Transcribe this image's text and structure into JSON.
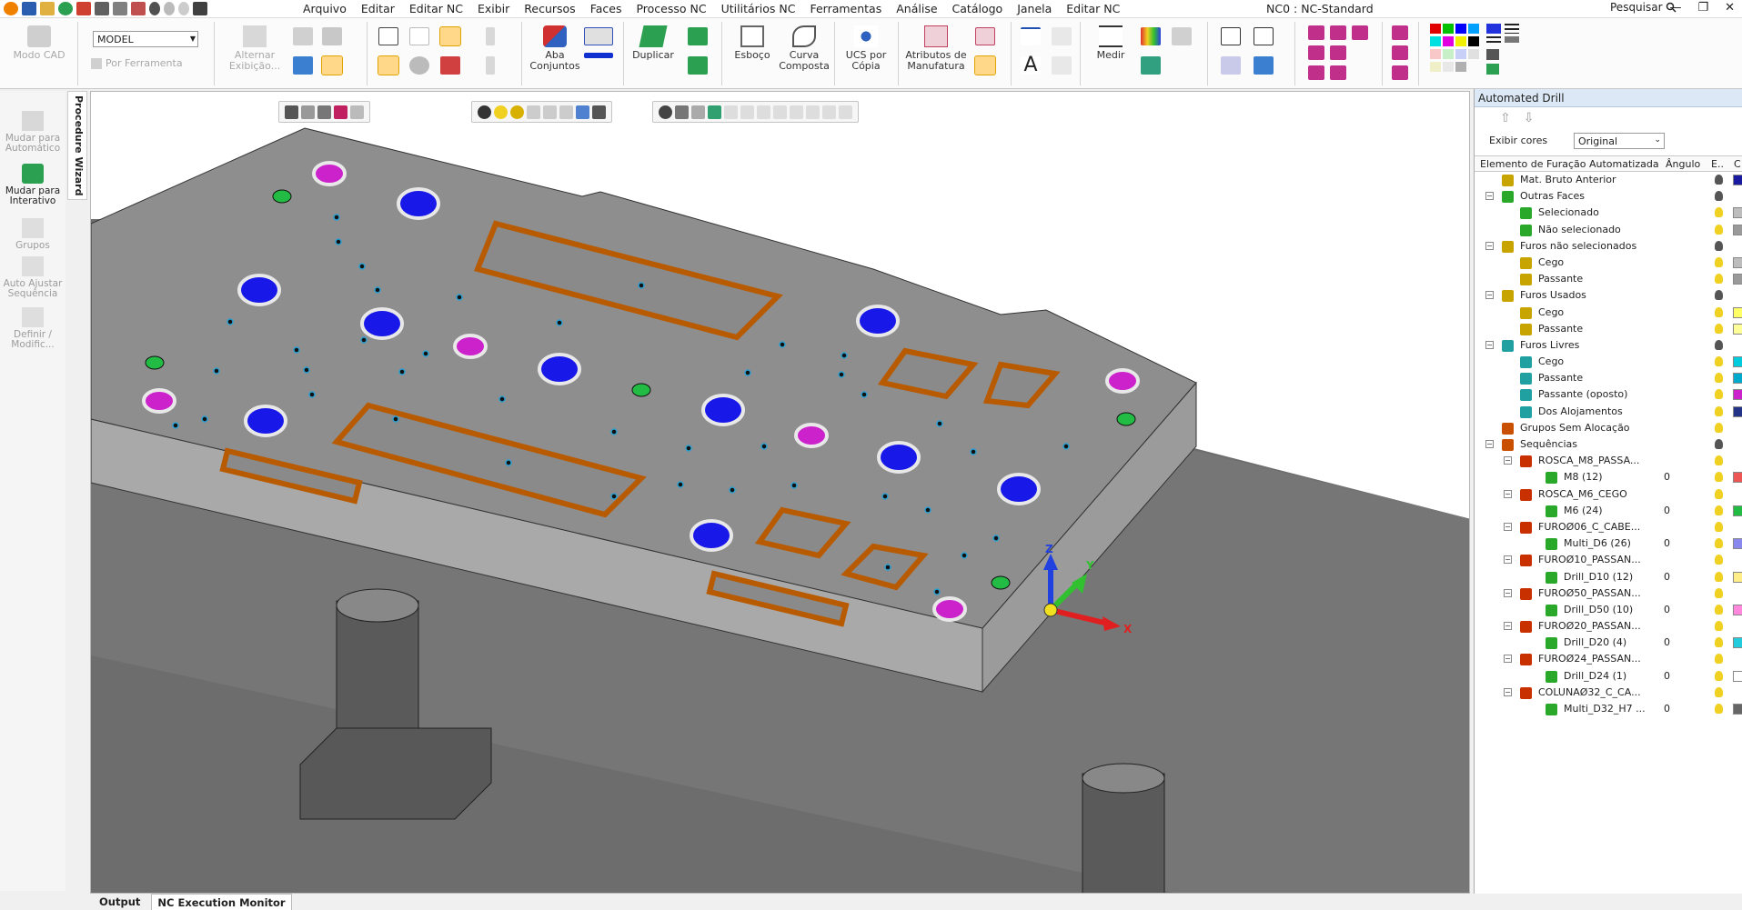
{
  "menu": [
    "Arquivo",
    "Editar",
    "Editar NC",
    "Exibir",
    "Recursos",
    "Faces",
    "Processo NC",
    "Utilitários NC",
    "Ferramentas",
    "Análise",
    "Catálogo",
    "Janela",
    "Editar NC"
  ],
  "app_title": "NC0 : NC-Standard",
  "search_label": "Pesquisar",
  "window_controls": [
    "—",
    "❐",
    "✕"
  ],
  "ribbon": {
    "modo_cad": "Modo CAD",
    "model_select": "MODEL",
    "por_ferramenta": "Por Ferramenta",
    "alternar_exibicao": "Alternar Exibição...",
    "aba_conjuntos": "Aba Conjuntos",
    "duplicar": "Duplicar",
    "esboco": "Esboço",
    "curva_composta": "Curva Composta",
    "ucs_por_copia": "UCS por Cópia",
    "atributos_manufatura": "Atributos de Manufatura",
    "medir": "Medir"
  },
  "left_panel": {
    "wizard_tab": "Procedure Wizard",
    "items": [
      {
        "label": "Mudar para Automático",
        "active": false
      },
      {
        "label": "Mudar para Interativo",
        "active": true
      },
      {
        "label": "Grupos",
        "active": false
      },
      {
        "label": "Auto Ajustar Sequência",
        "active": false
      },
      {
        "label": "Definir / Modific...",
        "active": false
      }
    ]
  },
  "bottom_tabs": [
    "Output",
    "NC Execution Monitor"
  ],
  "axes": {
    "x": "X",
    "y": "Y",
    "z": "Z"
  },
  "drill_panel": {
    "title": "Automated Drill",
    "exibir_cores_label": "Exibir cores",
    "exibir_cores_value": "Original",
    "col_element": "Elemento de Furação Automatizada",
    "col_angle": "Ângulo",
    "col_e": "E..",
    "col_c": "C",
    "rows": [
      {
        "label": "Mat. Bruto Anterior",
        "level": 1,
        "toggle": "",
        "icon": "#c8a400",
        "value": "",
        "swatch": "#1a1aa0"
      },
      {
        "label": "Outras Faces",
        "level": 1,
        "toggle": "−",
        "icon": "#2aa82a",
        "value": "",
        "swatch": ""
      },
      {
        "label": "Selecionado",
        "level": 2,
        "toggle": "",
        "icon": "#2aa82a",
        "value": "",
        "swatch": "#bdbdbd"
      },
      {
        "label": "Não selecionado",
        "level": 2,
        "toggle": "",
        "icon": "#2aa82a",
        "value": "",
        "swatch": "#9a9a9a"
      },
      {
        "label": "Furos não selecionados",
        "level": 1,
        "toggle": "−",
        "icon": "#c8a400",
        "value": "",
        "swatch": ""
      },
      {
        "label": "Cego",
        "level": 2,
        "toggle": "",
        "icon": "#c8a400",
        "value": "",
        "swatch": "#bdbdbd"
      },
      {
        "label": "Passante",
        "level": 2,
        "toggle": "",
        "icon": "#c8a400",
        "value": "",
        "swatch": "#9a9a9a"
      },
      {
        "label": "Furos Usados",
        "level": 1,
        "toggle": "−",
        "icon": "#c8a400",
        "value": "",
        "swatch": ""
      },
      {
        "label": "Cego",
        "level": 2,
        "toggle": "",
        "icon": "#c8a400",
        "value": "",
        "swatch": "#ffff66"
      },
      {
        "label": "Passante",
        "level": 2,
        "toggle": "",
        "icon": "#c8a400",
        "value": "",
        "swatch": "#ffff99"
      },
      {
        "label": "Furos Livres",
        "level": 1,
        "toggle": "−",
        "icon": "#20a0a0",
        "value": "",
        "swatch": ""
      },
      {
        "label": "Cego",
        "level": 2,
        "toggle": "",
        "icon": "#20a0a0",
        "value": "",
        "swatch": "#00ccdd"
      },
      {
        "label": "Passante",
        "level": 2,
        "toggle": "",
        "icon": "#20a0a0",
        "value": "",
        "swatch": "#00aacc"
      },
      {
        "label": "Passante (oposto)",
        "level": 2,
        "toggle": "",
        "icon": "#20a0a0",
        "value": "",
        "swatch": "#cc22cc"
      },
      {
        "label": "Dos Alojamentos",
        "level": 2,
        "toggle": "",
        "icon": "#20a0a0",
        "value": "",
        "swatch": "#223388"
      },
      {
        "label": "Grupos Sem Alocação",
        "level": 1,
        "toggle": "",
        "icon": "#c85000",
        "value": "",
        "swatch": ""
      },
      {
        "label": "Sequências",
        "level": 1,
        "toggle": "−",
        "icon": "#c85000",
        "value": "",
        "swatch": ""
      },
      {
        "label": "ROSCA_M8_PASSA...",
        "level": 2,
        "toggle": "−",
        "icon": "#c83000",
        "value": "",
        "swatch": ""
      },
      {
        "label": "M8 (12)",
        "level": 3,
        "toggle": "",
        "icon": "#2aa82a",
        "value": "0",
        "swatch": "#ee5555"
      },
      {
        "label": "ROSCA_M6_CEGO",
        "level": 2,
        "toggle": "−",
        "icon": "#c83000",
        "value": "",
        "swatch": ""
      },
      {
        "label": "M6 (24)",
        "level": 3,
        "toggle": "",
        "icon": "#2aa82a",
        "value": "0",
        "swatch": "#22bb44"
      },
      {
        "label": "FUROØ06_C_CABE...",
        "level": 2,
        "toggle": "−",
        "icon": "#c83000",
        "value": "",
        "swatch": ""
      },
      {
        "label": "Multi_D6 (26)",
        "level": 3,
        "toggle": "",
        "icon": "#2aa82a",
        "value": "0",
        "swatch": "#8888ee"
      },
      {
        "label": "FUROØ10_PASSAN...",
        "level": 2,
        "toggle": "−",
        "icon": "#c83000",
        "value": "",
        "swatch": ""
      },
      {
        "label": "Drill_D10 (12)",
        "level": 3,
        "toggle": "",
        "icon": "#2aa82a",
        "value": "0",
        "swatch": "#ffee88"
      },
      {
        "label": "FUROØ50_PASSAN...",
        "level": 2,
        "toggle": "−",
        "icon": "#c83000",
        "value": "",
        "swatch": ""
      },
      {
        "label": "Drill_D50 (10)",
        "level": 3,
        "toggle": "",
        "icon": "#2aa82a",
        "value": "0",
        "swatch": "#ff88dd"
      },
      {
        "label": "FUROØ20_PASSAN...",
        "level": 2,
        "toggle": "−",
        "icon": "#c83000",
        "value": "",
        "swatch": ""
      },
      {
        "label": "Drill_D20 (4)",
        "level": 3,
        "toggle": "",
        "icon": "#2aa82a",
        "value": "0",
        "swatch": "#22ccdd"
      },
      {
        "label": "FUROØ24_PASSAN...",
        "level": 2,
        "toggle": "−",
        "icon": "#c83000",
        "value": "",
        "swatch": ""
      },
      {
        "label": "Drill_D24 (1)",
        "level": 3,
        "toggle": "",
        "icon": "#2aa82a",
        "value": "0",
        "swatch": "#ffffff"
      },
      {
        "label": "COLUNAØ32_C_CA...",
        "level": 2,
        "toggle": "−",
        "icon": "#c83000",
        "value": "",
        "swatch": ""
      },
      {
        "label": "Multi_D32_H7 ...",
        "level": 3,
        "toggle": "",
        "icon": "#2aa82a",
        "value": "0",
        "swatch": "#666666"
      }
    ]
  }
}
